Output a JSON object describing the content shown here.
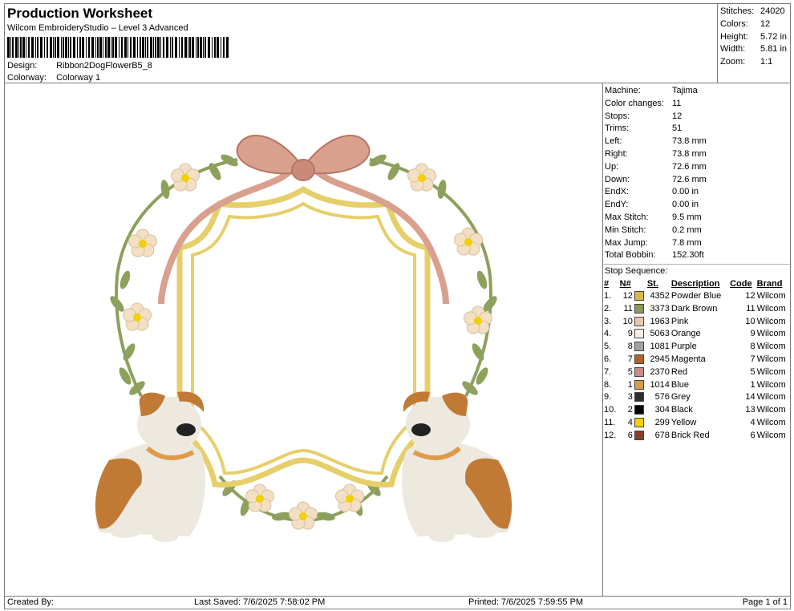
{
  "header": {
    "title": "Production Worksheet",
    "subtitle": "Wilcom EmbroideryStudio – Level 3 Advanced",
    "design_label": "Design:",
    "design_value": "Ribbon2DogFlowerB5_8",
    "colorway_label": "Colorway:",
    "colorway_value": "Colorway 1"
  },
  "summary": [
    {
      "label": "Stitches:",
      "value": "24020"
    },
    {
      "label": "Colors:",
      "value": "12"
    },
    {
      "label": "Height:",
      "value": "5.72 in"
    },
    {
      "label": "Width:",
      "value": "5.81 in"
    },
    {
      "label": "Zoom:",
      "value": "1:1"
    }
  ],
  "machine_info": [
    {
      "label": "Machine:",
      "value": "Tajima"
    },
    {
      "label": "Color changes:",
      "value": "11"
    },
    {
      "label": "Stops:",
      "value": "12"
    },
    {
      "label": "Trims:",
      "value": "51"
    },
    {
      "label": "Left:",
      "value": "73.8 mm"
    },
    {
      "label": "Right:",
      "value": "73.8 mm"
    },
    {
      "label": "Up:",
      "value": "72.6 mm"
    },
    {
      "label": "Down:",
      "value": "72.6 mm"
    },
    {
      "label": "EndX:",
      "value": "0.00 in"
    },
    {
      "label": "EndY:",
      "value": "0.00 in"
    },
    {
      "label": "Max Stitch:",
      "value": "9.5 mm"
    },
    {
      "label": "Min Stitch:",
      "value": "0.2 mm"
    },
    {
      "label": "Max Jump:",
      "value": "7.8 mm"
    },
    {
      "label": "Total Bobbin:",
      "value": "152.30ft"
    }
  ],
  "stop_sequence": {
    "title": "Stop Sequence:",
    "headers": {
      "num": "#",
      "n": "N#",
      "st": "St.",
      "desc": "Description",
      "code": "Code",
      "brand": "Brand"
    },
    "rows": [
      {
        "num": "1.",
        "n": "12",
        "color": "#d8b84a",
        "st": "4352",
        "desc": "Powder Blue",
        "code": "12",
        "brand": "Wilcom"
      },
      {
        "num": "2.",
        "n": "11",
        "color": "#8a9a5a",
        "st": "3373",
        "desc": "Dark Brown",
        "code": "11",
        "brand": "Wilcom"
      },
      {
        "num": "3.",
        "n": "10",
        "color": "#ecc6aa",
        "st": "1963",
        "desc": "Pink",
        "code": "10",
        "brand": "Wilcom"
      },
      {
        "num": "4.",
        "n": "9",
        "color": "#f6ece4",
        "st": "5063",
        "desc": "Orange",
        "code": "9",
        "brand": "Wilcom"
      },
      {
        "num": "5.",
        "n": "8",
        "color": "#a2a2a2",
        "st": "1081",
        "desc": "Purple",
        "code": "8",
        "brand": "Wilcom"
      },
      {
        "num": "6.",
        "n": "7",
        "color": "#b0622a",
        "st": "2945",
        "desc": "Magenta",
        "code": "7",
        "brand": "Wilcom"
      },
      {
        "num": "7.",
        "n": "5",
        "color": "#c88c8a",
        "st": "2370",
        "desc": "Red",
        "code": "5",
        "brand": "Wilcom"
      },
      {
        "num": "8.",
        "n": "1",
        "color": "#e09a48",
        "st": "1014",
        "desc": "Blue",
        "code": "1",
        "brand": "Wilcom"
      },
      {
        "num": "9.",
        "n": "3",
        "color": "#2e2e2e",
        "st": "576",
        "desc": "Grey",
        "code": "14",
        "brand": "Wilcom"
      },
      {
        "num": "10.",
        "n": "2",
        "color": "#050505",
        "st": "304",
        "desc": "Black",
        "code": "13",
        "brand": "Wilcom"
      },
      {
        "num": "11.",
        "n": "4",
        "color": "#f2d000",
        "st": "299",
        "desc": "Yellow",
        "code": "4",
        "brand": "Wilcom"
      },
      {
        "num": "12.",
        "n": "6",
        "color": "#8c3e28",
        "st": "678",
        "desc": "Brick Red",
        "code": "6",
        "brand": "Wilcom"
      }
    ]
  },
  "footer": {
    "created": "Created By:",
    "saved": "Last Saved: 7/6/2025 7:58:02 PM",
    "printed": "Printed: 7/6/2025 7:59:55 PM",
    "page": "Page 1 of 1"
  },
  "art_colors": {
    "frame": "#e6cf6a",
    "frame_dark": "#c9ad3f",
    "ribbon": "#d9a08e",
    "ribbon_dark": "#b77563",
    "leaf": "#8da05c",
    "petal": "#f2dfc4",
    "center": "#f2d000",
    "dog_brown": "#c17a35",
    "dog_white": "#ede9df",
    "dog_black": "#222222"
  }
}
